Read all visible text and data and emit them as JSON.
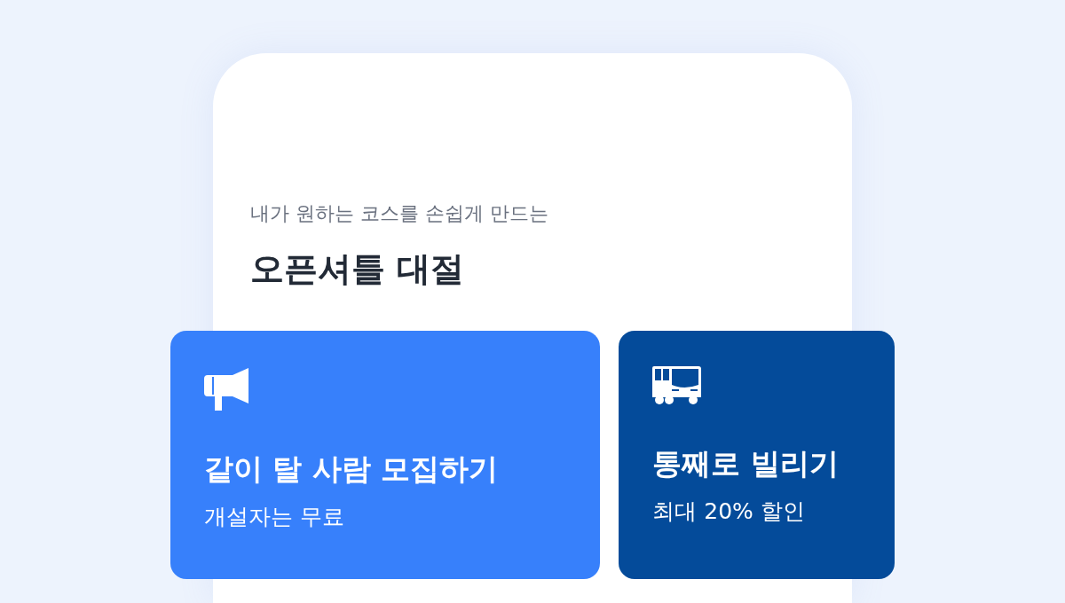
{
  "header": {
    "subtitle": "내가 원하는 코스를 손쉽게 만드는",
    "title": "오픈셔틀 대절"
  },
  "cards": [
    {
      "kind": "recruit",
      "color": "#3780fb",
      "title": "같이 탈 사람 모집하기",
      "caption": "개설자는 무료"
    },
    {
      "kind": "rent",
      "color": "#044b9a",
      "title": "통째로 빌리기",
      "caption": "최대 20% 할인"
    }
  ]
}
